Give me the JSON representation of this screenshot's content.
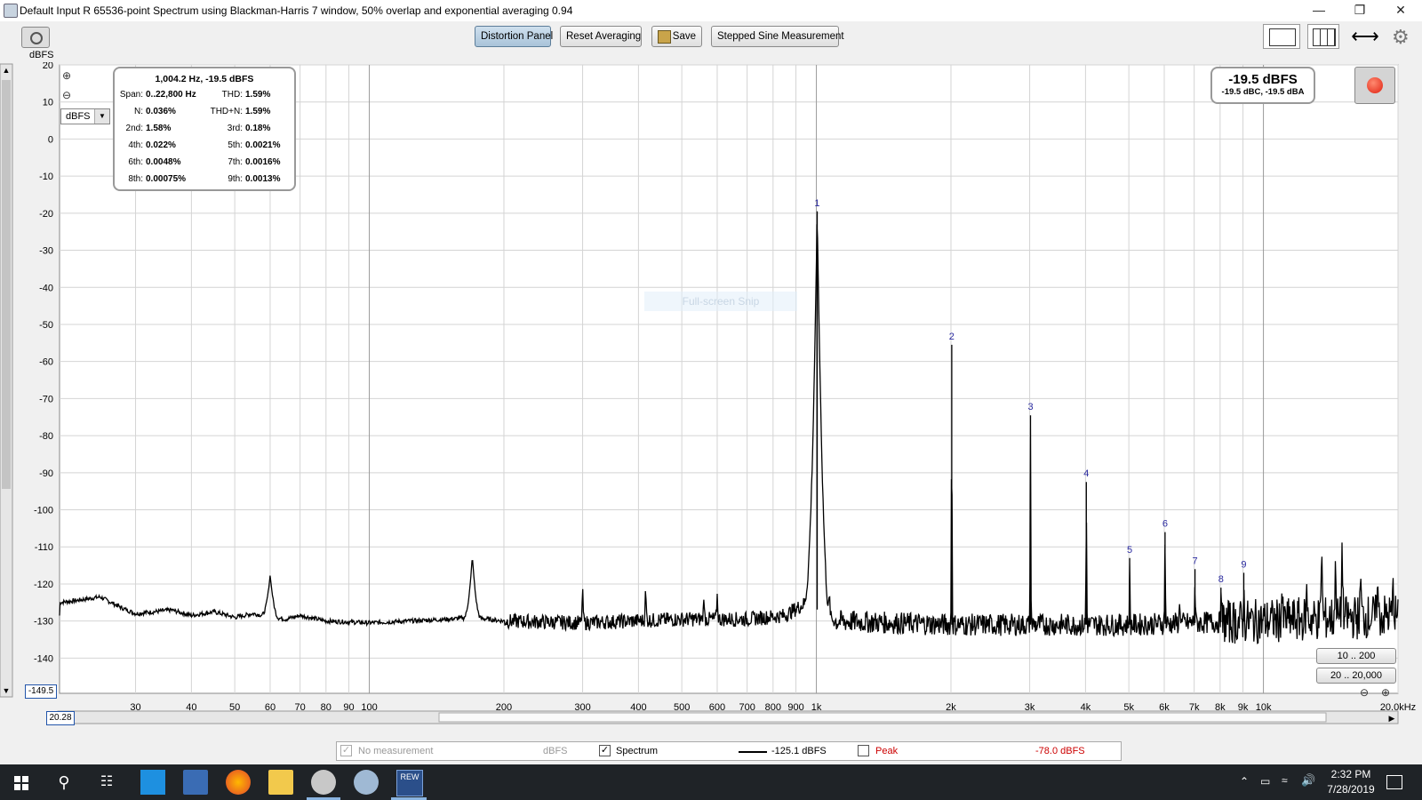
{
  "window": {
    "title": "Default Input R 65536-point Spectrum using Blackman-Harris 7 window, 50% overlap and exponential averaging 0.94",
    "controls": [
      "minimize",
      "restore",
      "close"
    ]
  },
  "toolbar": {
    "distortion_panel": "Distortion Panel",
    "reset_averaging": "Reset Averaging",
    "save": "Save",
    "stepped_sine": "Stepped Sine Measurement"
  },
  "graph": {
    "y_unit": "dBFS",
    "unit_select": "dBFS",
    "y_min_value": "-149.5",
    "x_min_value": "20.28",
    "snip_watermark": "Full-screen Snip"
  },
  "distortion": {
    "header": "1,004.2 Hz, -19.5 dBFS",
    "rows": [
      {
        "l1": "Span:",
        "v1": "0..22,800 Hz",
        "l2": "THD:",
        "v2": "1.59%"
      },
      {
        "l1": "N:",
        "v1": "0.036%",
        "l2": "THD+N:",
        "v2": "1.59%"
      },
      {
        "l1": "2nd:",
        "v1": "1.58%",
        "l2": "3rd:",
        "v2": "0.18%"
      },
      {
        "l1": "4th:",
        "v1": "0.022%",
        "l2": "5th:",
        "v2": "0.0021%"
      },
      {
        "l1": "6th:",
        "v1": "0.0048%",
        "l2": "7th:",
        "v2": "0.0016%"
      },
      {
        "l1": "8th:",
        "v1": "0.00075%",
        "l2": "9th:",
        "v2": "0.0013%"
      }
    ]
  },
  "level": {
    "main": "-19.5 dBFS",
    "sub": "-19.5 dBC, -19.5 dBA"
  },
  "range_buttons": [
    "10 .. 200",
    "20 .. 20,000"
  ],
  "legend": {
    "no_measurement": "No measurement",
    "no_measurement_unit": "dBFS",
    "spectrum": "Spectrum",
    "spectrum_value": "-125.1 dBFS",
    "peak": "Peak",
    "peak_value": "-78.0 dBFS",
    "peak_color": "#cc0000"
  },
  "taskbar": {
    "time": "2:32 PM",
    "date": "7/28/2019"
  },
  "chart_data": {
    "type": "line",
    "title": "",
    "xlabel": "",
    "ylabel": "dBFS",
    "x_scale": "log",
    "xlim": [
      20.28,
      20000
    ],
    "ylim": [
      -149.5,
      20
    ],
    "y_ticks": [
      20,
      10,
      0,
      -10,
      -20,
      -30,
      -40,
      -50,
      -60,
      -70,
      -80,
      -90,
      -100,
      -110,
      -120,
      -130,
      -140
    ],
    "x_ticks": [
      {
        "v": 30,
        "label": "30"
      },
      {
        "v": 40,
        "label": "40"
      },
      {
        "v": 50,
        "label": "50"
      },
      {
        "v": 60,
        "label": "60"
      },
      {
        "v": 70,
        "label": "70"
      },
      {
        "v": 80,
        "label": "80"
      },
      {
        "v": 90,
        "label": "90"
      },
      {
        "v": 100,
        "label": "100"
      },
      {
        "v": 200,
        "label": "200"
      },
      {
        "v": 300,
        "label": "300"
      },
      {
        "v": 400,
        "label": "400"
      },
      {
        "v": 500,
        "label": "500"
      },
      {
        "v": 600,
        "label": "600"
      },
      {
        "v": 700,
        "label": "700"
      },
      {
        "v": 800,
        "label": "800"
      },
      {
        "v": 900,
        "label": "900"
      },
      {
        "v": 1000,
        "label": "1k"
      },
      {
        "v": 2000,
        "label": "2k"
      },
      {
        "v": 3000,
        "label": "3k"
      },
      {
        "v": 4000,
        "label": "4k"
      },
      {
        "v": 5000,
        "label": "5k"
      },
      {
        "v": 6000,
        "label": "6k"
      },
      {
        "v": 7000,
        "label": "7k"
      },
      {
        "v": 8000,
        "label": "8k"
      },
      {
        "v": 9000,
        "label": "9k"
      },
      {
        "v": 10000,
        "label": "10k"
      },
      {
        "v": 20000,
        "label": "20.0kHz"
      }
    ],
    "grid": true,
    "noise_floor": [
      [
        20.28,
        -125
      ],
      [
        22,
        -124.5
      ],
      [
        25,
        -123.5
      ],
      [
        28,
        -126.5
      ],
      [
        30,
        -128
      ],
      [
        33,
        -127.5
      ],
      [
        36,
        -127
      ],
      [
        40,
        -128.5
      ],
      [
        45,
        -127.5
      ],
      [
        50,
        -129
      ],
      [
        55,
        -128
      ],
      [
        58,
        -128.5
      ],
      [
        65,
        -129.5
      ],
      [
        70,
        -128.5
      ],
      [
        80,
        -130
      ],
      [
        100,
        -130.5
      ],
      [
        150,
        -129.5
      ],
      [
        170,
        -129
      ],
      [
        200,
        -130
      ],
      [
        300,
        -130.5
      ],
      [
        500,
        -129.5
      ],
      [
        700,
        -129.5
      ],
      [
        850,
        -128.5
      ],
      [
        950,
        -125
      ],
      [
        1100,
        -130
      ],
      [
        2000,
        -131
      ],
      [
        5000,
        -131
      ],
      [
        10000,
        -130
      ],
      [
        20000,
        -128.5
      ]
    ],
    "spurs": [
      [
        60,
        -117.5
      ],
      [
        170,
        -112.5
      ],
      [
        300,
        -120
      ],
      [
        415,
        -120
      ],
      [
        560,
        -124
      ],
      [
        600,
        -122.5
      ],
      [
        1070,
        -122
      ],
      [
        6500,
        -124
      ],
      [
        11000,
        -121
      ],
      [
        12500,
        -120
      ],
      [
        13500,
        -106
      ],
      [
        14500,
        -110
      ],
      [
        15000,
        -106
      ],
      [
        16500,
        -115
      ],
      [
        18000,
        -117
      ],
      [
        19500,
        -118
      ]
    ],
    "series": [
      {
        "name": "Spectrum",
        "harmonics": [
          {
            "label": "1",
            "freq": 1004.2,
            "level": -19.5
          },
          {
            "label": "2",
            "freq": 2008,
            "level": -55.5
          },
          {
            "label": "3",
            "freq": 3013,
            "level": -74.5
          },
          {
            "label": "4",
            "freq": 4017,
            "level": -92.5
          },
          {
            "label": "5",
            "freq": 5021,
            "level": -113
          },
          {
            "label": "6",
            "freq": 6025,
            "level": -106
          },
          {
            "label": "7",
            "freq": 7029,
            "level": -116
          },
          {
            "label": "8",
            "freq": 8034,
            "level": -121
          },
          {
            "label": "9",
            "freq": 9038,
            "level": -117
          }
        ]
      }
    ]
  }
}
